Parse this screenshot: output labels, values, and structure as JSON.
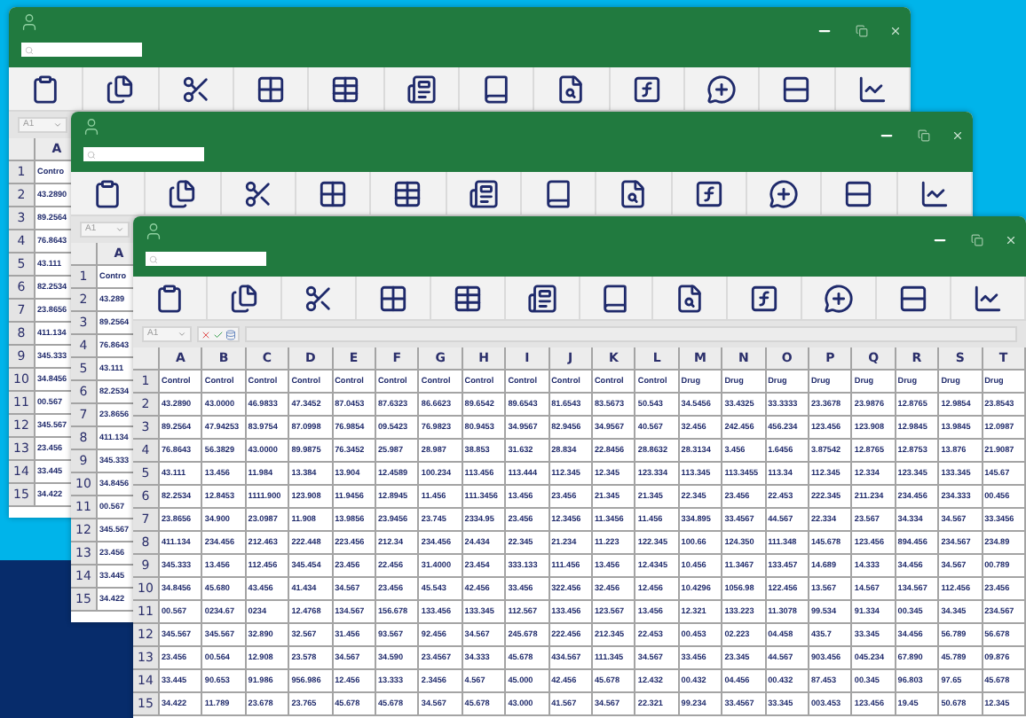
{
  "windows": [
    {
      "name_box": "A1",
      "columns": [
        "A"
      ],
      "rows": [
        {
          "header": "1",
          "cells": [
            "Contro"
          ]
        },
        {
          "header": "2",
          "cells": [
            "43.2890"
          ]
        },
        {
          "header": "3",
          "cells": [
            "89.2564"
          ]
        },
        {
          "header": "4",
          "cells": [
            "76.8643"
          ]
        },
        {
          "header": "5",
          "cells": [
            "43.111"
          ]
        },
        {
          "header": "6",
          "cells": [
            "82.2534"
          ]
        },
        {
          "header": "7",
          "cells": [
            "23.8656"
          ]
        },
        {
          "header": "8",
          "cells": [
            "411.134"
          ]
        },
        {
          "header": "9",
          "cells": [
            "345.333"
          ]
        },
        {
          "header": "10",
          "cells": [
            "34.8456"
          ]
        },
        {
          "header": "11",
          "cells": [
            "00.567"
          ]
        },
        {
          "header": "12",
          "cells": [
            "345.567"
          ]
        },
        {
          "header": "13",
          "cells": [
            "23.456"
          ]
        },
        {
          "header": "14",
          "cells": [
            "33.445"
          ]
        },
        {
          "header": "15",
          "cells": [
            "34.422"
          ]
        }
      ]
    },
    {
      "name_box": "A1",
      "columns": [
        "A"
      ],
      "rows": [
        {
          "header": "1",
          "cells": [
            "Contro"
          ]
        },
        {
          "header": "2",
          "cells": [
            "43.289"
          ]
        },
        {
          "header": "3",
          "cells": [
            "89.2564"
          ]
        },
        {
          "header": "4",
          "cells": [
            "76.8643"
          ]
        },
        {
          "header": "5",
          "cells": [
            "43.111"
          ]
        },
        {
          "header": "6",
          "cells": [
            "82.2534"
          ]
        },
        {
          "header": "7",
          "cells": [
            "23.8656"
          ]
        },
        {
          "header": "8",
          "cells": [
            "411.134"
          ]
        },
        {
          "header": "9",
          "cells": [
            "345.333"
          ]
        },
        {
          "header": "10",
          "cells": [
            "34.8456"
          ]
        },
        {
          "header": "11",
          "cells": [
            "00.567"
          ]
        },
        {
          "header": "12",
          "cells": [
            "345.567"
          ]
        },
        {
          "header": "13",
          "cells": [
            "23.456"
          ]
        },
        {
          "header": "14",
          "cells": [
            "33.445"
          ]
        },
        {
          "header": "15",
          "cells": [
            "34.422"
          ]
        }
      ]
    },
    {
      "name_box": "A1",
      "columns": [
        "A",
        "B",
        "C",
        "D",
        "E",
        "F",
        "G",
        "H",
        "I",
        "J",
        "K",
        "L",
        "M",
        "N",
        "O",
        "P",
        "Q",
        "R",
        "S",
        "T"
      ],
      "rows": [
        {
          "header": "1",
          "cells": [
            "Control",
            "Control",
            "Control",
            "Control",
            "Control",
            "Control",
            "Control",
            "Control",
            "Control",
            "Control",
            "Control",
            "Control",
            "Drug",
            "Drug",
            "Drug",
            "Drug",
            "Drug",
            "Drug",
            "Drug",
            "Drug"
          ]
        },
        {
          "header": "2",
          "cells": [
            "43.2890",
            "43.0000",
            "46.9833",
            "47.3452",
            "87.0453",
            "87.6323",
            "86.6623",
            "89.6542",
            "89.6543",
            "81.6543",
            "83.5673",
            "50.543",
            "34.5456",
            "33.4325",
            "33.3333",
            "23.3678",
            "23.9876",
            "12.8765",
            "12.9854",
            "23.8543"
          ]
        },
        {
          "header": "3",
          "cells": [
            "89.2564",
            "47.94253",
            "83.9754",
            "87.0998",
            "76.9854",
            "09.5423",
            "76.9823",
            "80.9453",
            "34.9567",
            "82.9456",
            "34.9567",
            "40.567",
            "32.456",
            "242.456",
            "456.234",
            "123.456",
            "123.908",
            "12.9845",
            "13.9845",
            "12.0987"
          ]
        },
        {
          "header": "4",
          "cells": [
            "76.8643",
            "56.3829",
            "43.0000",
            "89.9875",
            "76.3452",
            "25.987",
            "28.987",
            "38.853",
            "31.632",
            "28.834",
            "22.8456",
            "28.8632",
            "28.3134",
            "3.456",
            "1.6456",
            "3.87542",
            "12.8765",
            "12.8753",
            "13.876",
            "21.9087"
          ]
        },
        {
          "header": "5",
          "cells": [
            "43.111",
            "13.456",
            "11.984",
            "13.384",
            "13.904",
            "12.4589",
            "100.234",
            "113.456",
            "113.444",
            "112.345",
            "12.345",
            "123.334",
            "113.345",
            "113.3455",
            "113.34",
            "112.345",
            "12.334",
            "123.345",
            "133.345",
            "145.67"
          ]
        },
        {
          "header": "6",
          "cells": [
            "82.2534",
            "12.8453",
            "1111.900",
            "123.908",
            "11.9456",
            "12.8945",
            "11.456",
            "111.3456",
            "13.456",
            "23.456",
            "21.345",
            "21.345",
            "22.345",
            "23.456",
            "22.453",
            "222.345",
            "211.234",
            "234.456",
            "234.333",
            "00.456"
          ]
        },
        {
          "header": "7",
          "cells": [
            "23.8656",
            "34.900",
            "23.0987",
            "11.908",
            "13.9856",
            "23.9456",
            "23.745",
            "2334.95",
            "23.456",
            "12.3456",
            "11.3456",
            "11.456",
            "334.895",
            "33.4567",
            "44.567",
            "22.334",
            "23.567",
            "34.334",
            "34.567",
            "33.3456"
          ]
        },
        {
          "header": "8",
          "cells": [
            "411.134",
            "234.456",
            "212.463",
            "222.448",
            "223.456",
            "212.34",
            "234.456",
            "24.434",
            "22.345",
            "21.234",
            "11.223",
            "122.345",
            "100.66",
            "124.350",
            "111.348",
            "145.678",
            "123.456",
            "894.456",
            "234.567",
            "234.89"
          ]
        },
        {
          "header": "9",
          "cells": [
            "345.333",
            "13.456",
            "112.456",
            "345.454",
            "23.456",
            "22.456",
            "31.4000",
            "23.454",
            "333.133",
            "111.456",
            "13.456",
            "12.4345",
            "10.456",
            "11.3467",
            "133.457",
            "14.689",
            "14.333",
            "34.456",
            "34.567",
            "00.789"
          ]
        },
        {
          "header": "10",
          "cells": [
            "34.8456",
            "45.680",
            "43.456",
            "41.434",
            "34.567",
            "23.456",
            "45.543",
            "42.456",
            "33.456",
            "322.456",
            "32.456",
            "12.456",
            "10.4296",
            "1056.98",
            "122.456",
            "13.567",
            "14.567",
            "134.567",
            "112.456",
            "23.456"
          ]
        },
        {
          "header": "11",
          "cells": [
            "00.567",
            "0234.67",
            "0234",
            "12.4768",
            "134.567",
            "156.678",
            "133.456",
            "133.345",
            "112.567",
            "133.456",
            "123.567",
            "13.456",
            "12.321",
            "133.223",
            "11.3078",
            "99.534",
            "91.334",
            "00.345",
            "34.345",
            "234.567"
          ]
        },
        {
          "header": "12",
          "cells": [
            "345.567",
            "345.567",
            "32.890",
            "32.567",
            "31.456",
            "93.567",
            "92.456",
            "34.567",
            "245.678",
            "222.456",
            "212.345",
            "22.453",
            "00.453",
            "02.223",
            "04.458",
            "435.7",
            "33.345",
            "34.456",
            "56.789",
            "56.678"
          ]
        },
        {
          "header": "13",
          "cells": [
            "23.456",
            "00.564",
            "12.908",
            "23.578",
            "34.567",
            "34.590",
            "23.4567",
            "34.333",
            "45.678",
            "434.567",
            "111.345",
            "34.567",
            "33.456",
            "23.345",
            "44.567",
            "903.456",
            "045.234",
            "67.890",
            "45.789",
            "09.876"
          ]
        },
        {
          "header": "14",
          "cells": [
            "33.445",
            "90.653",
            "91.986",
            "956.986",
            "12.456",
            "13.333",
            "2.3456",
            "4.567",
            "45.000",
            "42.456",
            "45.678",
            "12.432",
            "00.432",
            "04.456",
            "00.432",
            "87.453",
            "00.345",
            "96.803",
            "97.65",
            "45.678"
          ]
        },
        {
          "header": "15",
          "cells": [
            "34.422",
            "11.789",
            "23.678",
            "23.765",
            "45.678",
            "45.678",
            "34.567",
            "45.678",
            "43.000",
            "41.567",
            "34.567",
            "22.321",
            "99.234",
            "33.4567",
            "33.345",
            "003.453",
            "123.456",
            "19.45",
            "50.678",
            "12.345"
          ]
        }
      ]
    }
  ]
}
